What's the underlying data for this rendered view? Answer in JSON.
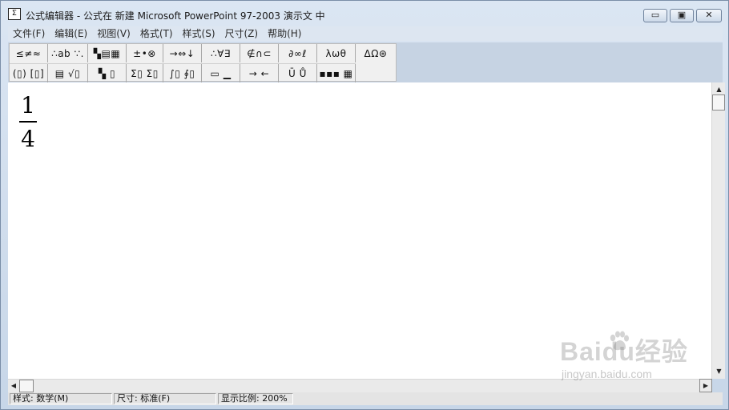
{
  "window": {
    "app_icon_text": "Σ",
    "title": "公式编辑器 - 公式在 新建 Microsoft PowerPoint 97-2003 演示文 中",
    "minimize_glyph": "▭",
    "maximize_glyph": "▣",
    "close_glyph": "✕"
  },
  "menu": {
    "items": [
      "文件(F)",
      "编辑(E)",
      "视图(V)",
      "格式(T)",
      "样式(S)",
      "尺寸(Z)",
      "帮助(H)"
    ]
  },
  "palette": {
    "row1": [
      "≤≠≈",
      "∴ab ∵.",
      "▚▤▦",
      "±•⊗",
      "→⇔↓",
      "∴∀∃",
      "∉∩⊂",
      "∂∞ℓ",
      "λωθ",
      "ΔΩ⊛"
    ],
    "row2": [
      "(▯) [▯]",
      "▤ √▯",
      "▚ ▯",
      "Σ▯ Σ▯",
      "∫▯ ∮▯",
      "▭ ▁",
      "→ ←",
      "Ū Ů",
      "▪▪▪ ▦"
    ]
  },
  "equation": {
    "numerator": "1",
    "denominator": "4"
  },
  "scrollbars": {
    "up_arrow": "▲",
    "down_arrow": "▼",
    "left_arrow": "◀",
    "right_arrow": "▶"
  },
  "status": {
    "style": "样式: 数学(M)",
    "size": "尺寸: 标准(F)",
    "zoom": "显示比例: 200%"
  },
  "watermark": {
    "logo": "Baidu经验",
    "url": "jingyan.baidu.com"
  }
}
